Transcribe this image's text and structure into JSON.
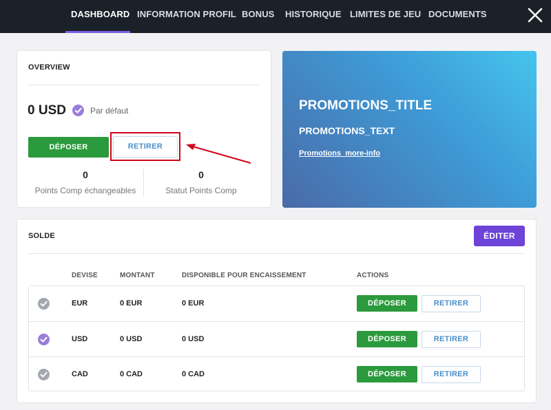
{
  "nav": {
    "tabs": [
      "DASHBOARD",
      "INFORMATION PROFIL",
      "BONUS",
      "HISTORIQUE",
      "LIMITES DE JEU",
      "DOCUMENTS"
    ],
    "active_tab": "DASHBOARD"
  },
  "overview": {
    "title": "OVERVIEW",
    "balance": "0 USD",
    "default_label": "Par défaut",
    "deposit_label": "DÉPOSER",
    "withdraw_label": "RETIRER",
    "comp_points_value": "0",
    "comp_points_label": "Points Comp échangeables",
    "comp_status_value": "0",
    "comp_status_label": "Statut Points Comp"
  },
  "promotions": {
    "title": "PROMOTIONS_TITLE",
    "text": "PROMOTIONS_TEXT",
    "link": "Promotions_more-info"
  },
  "balance_section": {
    "title": "SOLDE",
    "edit_label": "ÉDITER",
    "columns": [
      "DEVISE",
      "MONTANT",
      "DISPONIBLE POUR ENCAISSEMENT",
      "ACTIONS"
    ],
    "rows": [
      {
        "currency": "EUR",
        "amount": "0 EUR",
        "available": "0 EUR",
        "is_default": false,
        "deposit": "DÉPOSER",
        "withdraw": "RETIRER"
      },
      {
        "currency": "USD",
        "amount": "0 USD",
        "available": "0 USD",
        "is_default": true,
        "deposit": "DÉPOSER",
        "withdraw": "RETIRER"
      },
      {
        "currency": "CAD",
        "amount": "0 CAD",
        "available": "0 CAD",
        "is_default": false,
        "deposit": "DÉPOSER",
        "withdraw": "RETIRER"
      }
    ]
  },
  "colors": {
    "accent_purple": "#6d43d8",
    "deposit_green": "#2b9a3c",
    "highlight_red": "#d0021b",
    "topbar": "#1b2129"
  }
}
